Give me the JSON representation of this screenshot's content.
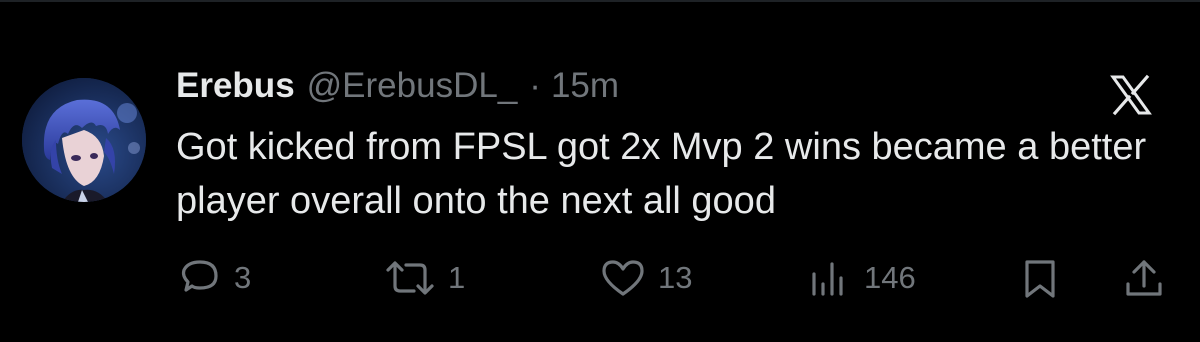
{
  "post": {
    "author": {
      "display_name": "Erebus",
      "handle": "@ErebusDL_",
      "avatar": "anime-character-blue-hair-avatar"
    },
    "separator": "·",
    "time": "15m",
    "text": "Got kicked from FPSL got 2x Mvp 2 wins became a better player overall onto the next all good",
    "platform_icon": "x-logo-icon"
  },
  "actions": {
    "replies": {
      "icon": "reply-icon",
      "count": "3"
    },
    "reposts": {
      "icon": "repost-icon",
      "count": "1"
    },
    "likes": {
      "icon": "heart-icon",
      "count": "13"
    },
    "views": {
      "icon": "views-chart-icon",
      "count": "146"
    },
    "bookmark": {
      "icon": "bookmark-icon"
    },
    "share": {
      "icon": "share-icon"
    }
  },
  "colors": {
    "background": "#000000",
    "primary_text": "#e7e9ea",
    "secondary_text": "#71767b",
    "border": "#1e2226"
  }
}
